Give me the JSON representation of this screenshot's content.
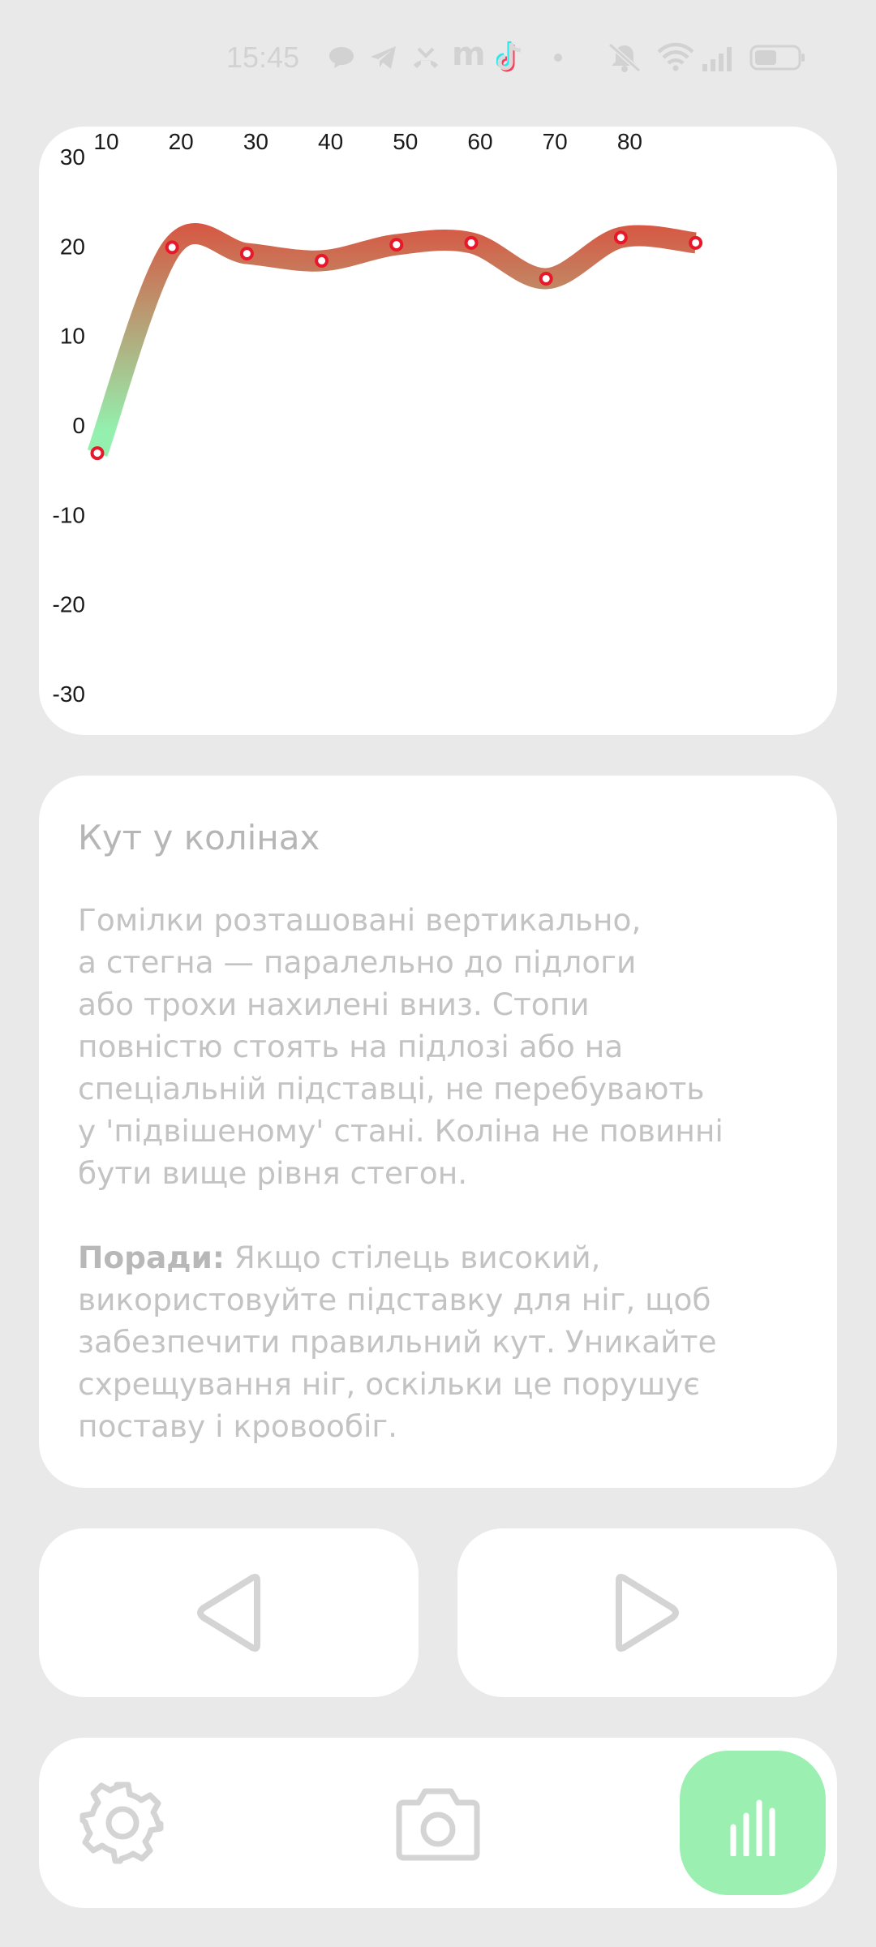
{
  "status_bar": {
    "time": "15:45",
    "icons": [
      "chat-bubble-icon",
      "telegram-icon",
      "missed-call-icon",
      "m-app-icon",
      "tiktok-icon",
      "dot-icon",
      "mute-icon",
      "wifi-icon",
      "signal-icon",
      "battery-icon"
    ],
    "m_app_label": "m"
  },
  "chart_data": {
    "type": "line",
    "x": [
      10,
      20,
      30,
      40,
      50,
      60,
      70,
      80,
      90
    ],
    "x_tick_labels": [
      "10",
      "20",
      "30",
      "40",
      "50",
      "60",
      "70",
      "80"
    ],
    "y_tick_labels": [
      "30",
      "20",
      "10",
      "0",
      "-10",
      "-20",
      "-30"
    ],
    "values": [
      -2.5,
      20.5,
      19.8,
      19.0,
      20.8,
      21.0,
      17.0,
      21.6,
      21.0
    ],
    "xlim": [
      10,
      90
    ],
    "ylim": [
      -30,
      30
    ],
    "colors": {
      "line_high": "#dc4b3a",
      "line_low": "#94f0ae",
      "marker": "#e8182b"
    },
    "grid": false,
    "title": "",
    "xlabel": "",
    "ylabel": ""
  },
  "info": {
    "title": "Кут у колінах",
    "description_lines": [
      "Гомілки розташовані вертикально,",
      "а стегна — паралельно до підлоги",
      "або трохи нахилені вниз. Стопи",
      "повністю стоять на підлозі або на",
      "спеціальній підставці, не перебувають",
      "у 'підвішеному' стані. Коліна не повинні",
      "бути вище рівня стегон."
    ],
    "tips_label": "Поради:",
    "tips_lines": [
      " Якщо стілець високий,",
      "використовуйте підставку для ніг, щоб",
      "забезпечити правильний кут. Уникайте",
      "схрещування ніг, оскільки це порушує",
      "поставу і кровообіг."
    ]
  },
  "navigation": {
    "prev_icon": "triangle-left-icon",
    "next_icon": "triangle-right-icon"
  },
  "toolbar": {
    "settings_icon": "gear-icon",
    "camera_icon": "camera-icon",
    "stats_icon": "bar-chart-icon",
    "stats_active_color": "#9bf0b1"
  }
}
